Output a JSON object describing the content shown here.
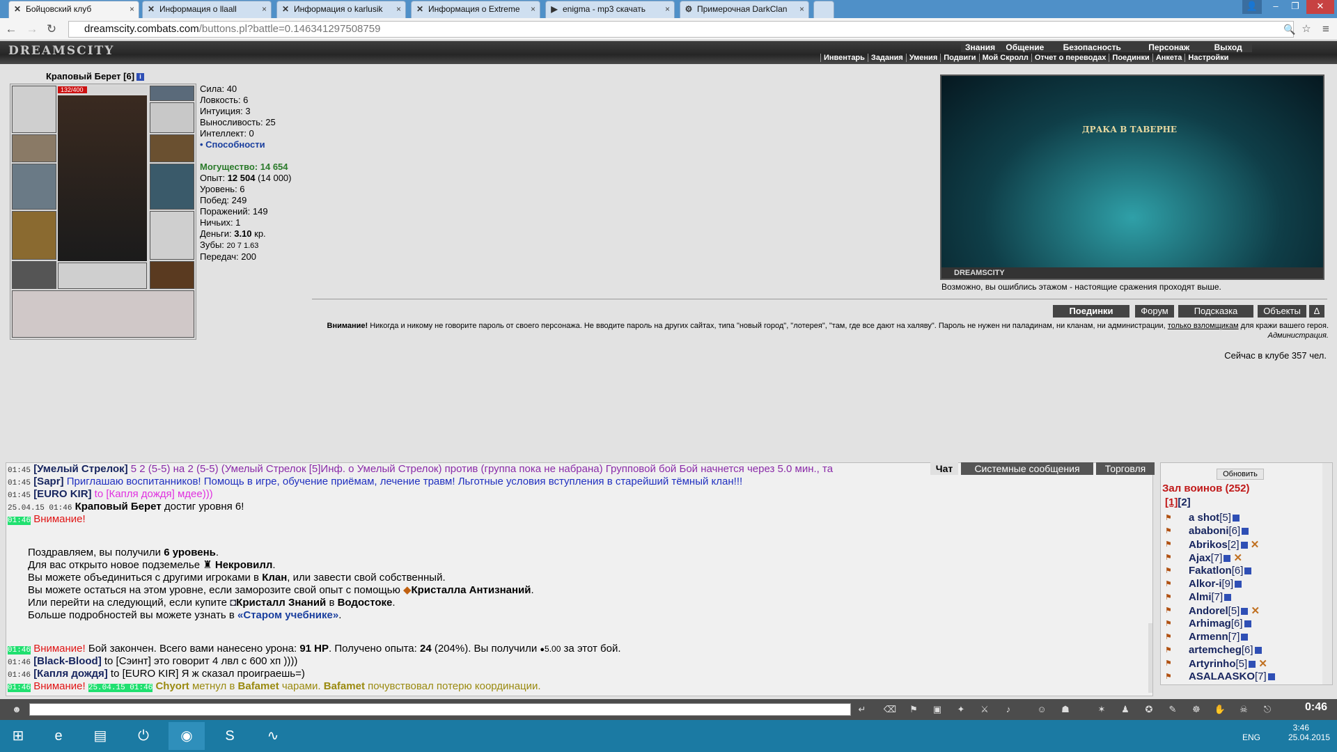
{
  "browser": {
    "tabs": [
      {
        "label": "Бойцовский клуб",
        "icon": "x-icon"
      },
      {
        "label": "Информация о llaall",
        "icon": "x-icon"
      },
      {
        "label": "Информация о karlusik",
        "icon": "x-icon"
      },
      {
        "label": "Информация о Extreme",
        "icon": "x-icon"
      },
      {
        "label": "enigma - mp3 скачать",
        "icon": "play-icon"
      },
      {
        "label": "Примерочная DarkClan",
        "icon": "gear-icon"
      }
    ],
    "url_host": "dreamscity.combats.com",
    "url_path": "/buttons.pl?battle=0.146341297508759"
  },
  "game": {
    "logo": "DREAMSCITY",
    "menu_top": [
      "Знания",
      "Общение",
      "Безопасность",
      "Персонаж",
      "Выход"
    ],
    "menu_sub": [
      "Инвентарь",
      "Задания",
      "Умения",
      "Подвиги",
      "Мой Скролл",
      "Отчет о переводах",
      "Поединки",
      "Анкета",
      "Настройки"
    ],
    "character": {
      "name": "Краповый Берет [6]",
      "hp": "132/400",
      "hp_fraction": 0.33
    },
    "stats": {
      "strength": "Сила: 40",
      "agility": "Ловкость: 6",
      "intuition": "Интуиция: 3",
      "endurance": "Выносливость: 25",
      "intellect": "Интеллект: 0",
      "abilities": "• Способности",
      "power": "Могущество: 14 654",
      "exp_label": "Опыт: ",
      "exp_value": "12 504",
      "exp_next": " (14 000)",
      "level": "Уровень: 6",
      "wins": "Побед: 249",
      "losses": "Поражений: 149",
      "draws": "Ничьих: 1",
      "money_label": "Деньги: ",
      "money_value": "3.10",
      "money_unit": " кр.",
      "teeth_label": "Зубы: ",
      "teeth_values": "20 7 1.63",
      "transfers": "Передач: 200"
    },
    "scene": {
      "title": "ДРАКА В ТАВЕРНЕ",
      "footer": "DREAMSCITY",
      "caption": "Возможно, вы ошиблись этажом - настоящие сражения проходят выше."
    },
    "buttons": [
      "Поединки",
      "Форум",
      "Подсказка",
      "Объекты",
      "Δ"
    ],
    "warning": {
      "lead": "Внимание!",
      "text": " Никогда и никому не говорите пароль от своего персонажа. Не вводите пароль на других сайтах, типа \"новый город\", \"лотерея\", \"там, где все дают на халяву\". Пароль не нужен ни паладинам, ни кланам, ни администрации, ",
      "link": "только взломщикам",
      "tail": " для кражи вашего героя.",
      "sign": "Администрация."
    },
    "online": "Сейчас в клубе 357 чел."
  },
  "chat": {
    "tabs": [
      "Чат",
      "Системные сообщения",
      "Торговля"
    ],
    "l1_time": "01:45",
    "l1_name": "[Умелый Стрелок]",
    "l1_text": " 5 2 (5-5) на 2 (5-5) (Умелый Стрелок [5]Инф. о Умелый Стрелок) против (группа пока не набрана) Групповой бой Бой начнется через 5.0 мин., та",
    "l2_time": "01:45",
    "l2_name": "[Sapr]",
    "l2_text": " Приглашаю воспитанников! Помощь в игре, обучение приёмам, лечение травм! Льготные условия вступления в старейший тёмный клан!!!",
    "l3_time": "01:45",
    "l3_name": "[EURO KIR]",
    "l3_text": " to [Капля дождя] мдее)))",
    "l4_time": "25.04.15 01:46",
    "l4_name": "Краповый Берет",
    "l4_text": " достиг уровня 6!",
    "l5_time": "01:46",
    "l5_text": "Внимание!",
    "s1a": "Поздравляем, вы получили ",
    "s1b": "6 уровень",
    "s2a": "Для вас открыто новое подземелье ",
    "s2b": "Некровилл",
    "s3a": "Вы можете объединиться с другими игроками в ",
    "s3b": "Клан",
    "s3c": ", или завести свой собственный.",
    "s4a": "Вы можете остаться на этом уровне, если заморозите свой опыт с помощью ",
    "s4b": "Кристалла Антизнаний",
    "s5a": "Или перейти на следующий, если купите ",
    "s5b": "Кристалл Знаний",
    "s5c": " в ",
    "s5d": "Водостоке",
    "s6a": "Больше подробностей вы можете узнать в ",
    "s6b": "«Старом учебнике»",
    "l6_time": "01:46",
    "l6_warn": "Внимание!",
    "l6_a": " Бой закончен. Всего вами нанесено урона: ",
    "l6_b": "91 HP",
    "l6_c": ". Получено опыта: ",
    "l6_d": "24",
    "l6_e": " (204%). Вы получили ",
    "l6_f": "5.00",
    "l6_g": " за этот бой.",
    "l7_time": "01:46",
    "l7_name": "[Black-Blood]",
    "l7_text": " to [Сэинт] это говорит 4 лвл с 600 хп ))))",
    "l8_time": "01:46",
    "l8_name": "[Капля дождя]",
    "l8_text": " to [EURO KIR] Я ж сказал проиграешь=)",
    "l9_time": "01:46",
    "l9_warn": "Внимание!",
    "l9_stamp": "25.04.15 01:46",
    "l9_a": "Chyort",
    "l9_b": " метнул в ",
    "l9_c": "Bafamet",
    "l9_d": " чарами. ",
    "l9_e": "Bafamet",
    "l9_f": " почувствовал потерю координации."
  },
  "sidebar": {
    "refresh": "Обновить",
    "hall": "Зал воинов (252)",
    "page1": "[1]",
    "page2": "[2]",
    "players": [
      {
        "name": "a shot",
        "lvl": "[5]"
      },
      {
        "name": "ababoni",
        "lvl": "[6]"
      },
      {
        "name": "Abrikos",
        "lvl": "[2]"
      },
      {
        "name": "Ajax",
        "lvl": "[7]"
      },
      {
        "name": "Fakatlon",
        "lvl": "[6]"
      },
      {
        "name": "Alkor-i",
        "lvl": "[9]"
      },
      {
        "name": "Almi",
        "lvl": "[7]"
      },
      {
        "name": "Andorel",
        "lvl": "[5]"
      },
      {
        "name": "Arhimag",
        "lvl": "[6]"
      },
      {
        "name": "Armenn",
        "lvl": "[7]"
      },
      {
        "name": "artemcheg",
        "lvl": "[6]"
      },
      {
        "name": "Artyrinho",
        "lvl": "[5]"
      },
      {
        "name": "ASALAASKO",
        "lvl": "[7]"
      }
    ]
  },
  "bottom": {
    "clock": "0:46"
  },
  "taskbar": {
    "lang": "ENG",
    "time": "3:46",
    "date": "25.04.2015"
  },
  "colors": {
    "accent": "#16245e",
    "alert": "#e01515",
    "hp": "#c11111"
  }
}
